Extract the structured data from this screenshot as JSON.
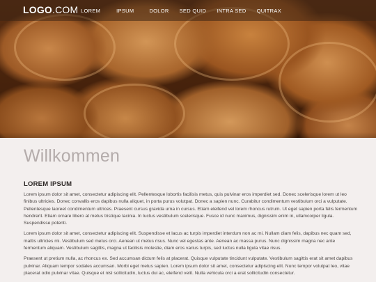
{
  "logo": {
    "strong": "LOGO",
    "light": ".COM"
  },
  "nav": {
    "items": [
      "LOREM",
      "IPSUM",
      "DOLOR",
      "SED QUID",
      "INTRA SED",
      "QUITRAX"
    ]
  },
  "hero": {
    "image": "croissants-photo"
  },
  "main": {
    "title": "Willkommen",
    "subtitle": "LOREM IPSUM",
    "paragraphs": [
      "Lorem ipsum dolor sit amet, consectetur adipiscing elit. Pellentesque lobortis facilisis metus, quis pulvinar eros imperdiet sed. Donec scelerisque lorem ut leo finibus ultricies. Donec convallis eros dapibus nulla aliquet, in porta purus volutpat. Donec a sapien nunc. Curabitur condimentum vestibulum orci a vulputate. Pellentesque laoreet condimentum ultrices. Praesent cursus gravida urna in cursus. Etiam eleifend vel lorem rhoncus rutrum. Ut eget sapien porta felis fermentum hendrerit. Etiam ornare libero at metus tristique lacinia. In luctus vestibulum scelerisque. Fusce id nunc maximus, dignissim enim in, ullamcorper ligula. Suspendisse potenti.",
      "Lorem ipsum dolor sit amet, consectetur adipiscing elit. Suspendisse et lacus ac turpis imperdiet interdum non ac mi. Nullam diam felis, dapibus nec quam sed, mattis ultricies mi. Vestibulum sed metus orci. Aenean ut metus risus. Nunc vel egestas ante. Aenean ac massa purus. Nunc dignissim magna nec ante fermentum aliquam. Vestibulum sagittis, magna ut facilisis molestie, diam eros varius turpis, sed luctus nulla ligula vitae risus.",
      "Praesent ut pretium nulla, ac rhoncus ex. Sed accumsan dictum felis at placerat. Quisque vulputate tincidunt vulputate. Vestibulum sagittis erat sit amet dapibus pulvinar. Aliquam tempor sodales accumsan. Morbi eget metus sapien. Lorem ipsum dolor sit amet, consectetur adipiscing elit. Nunc tempor volutpat leo, vitae placerat odio pulvinar vitae. Quisque et nisl sollicitudin, luctus dui ac, eleifend velit. Nulla vehicula orci a erat sollicitudin consectetur."
    ]
  }
}
